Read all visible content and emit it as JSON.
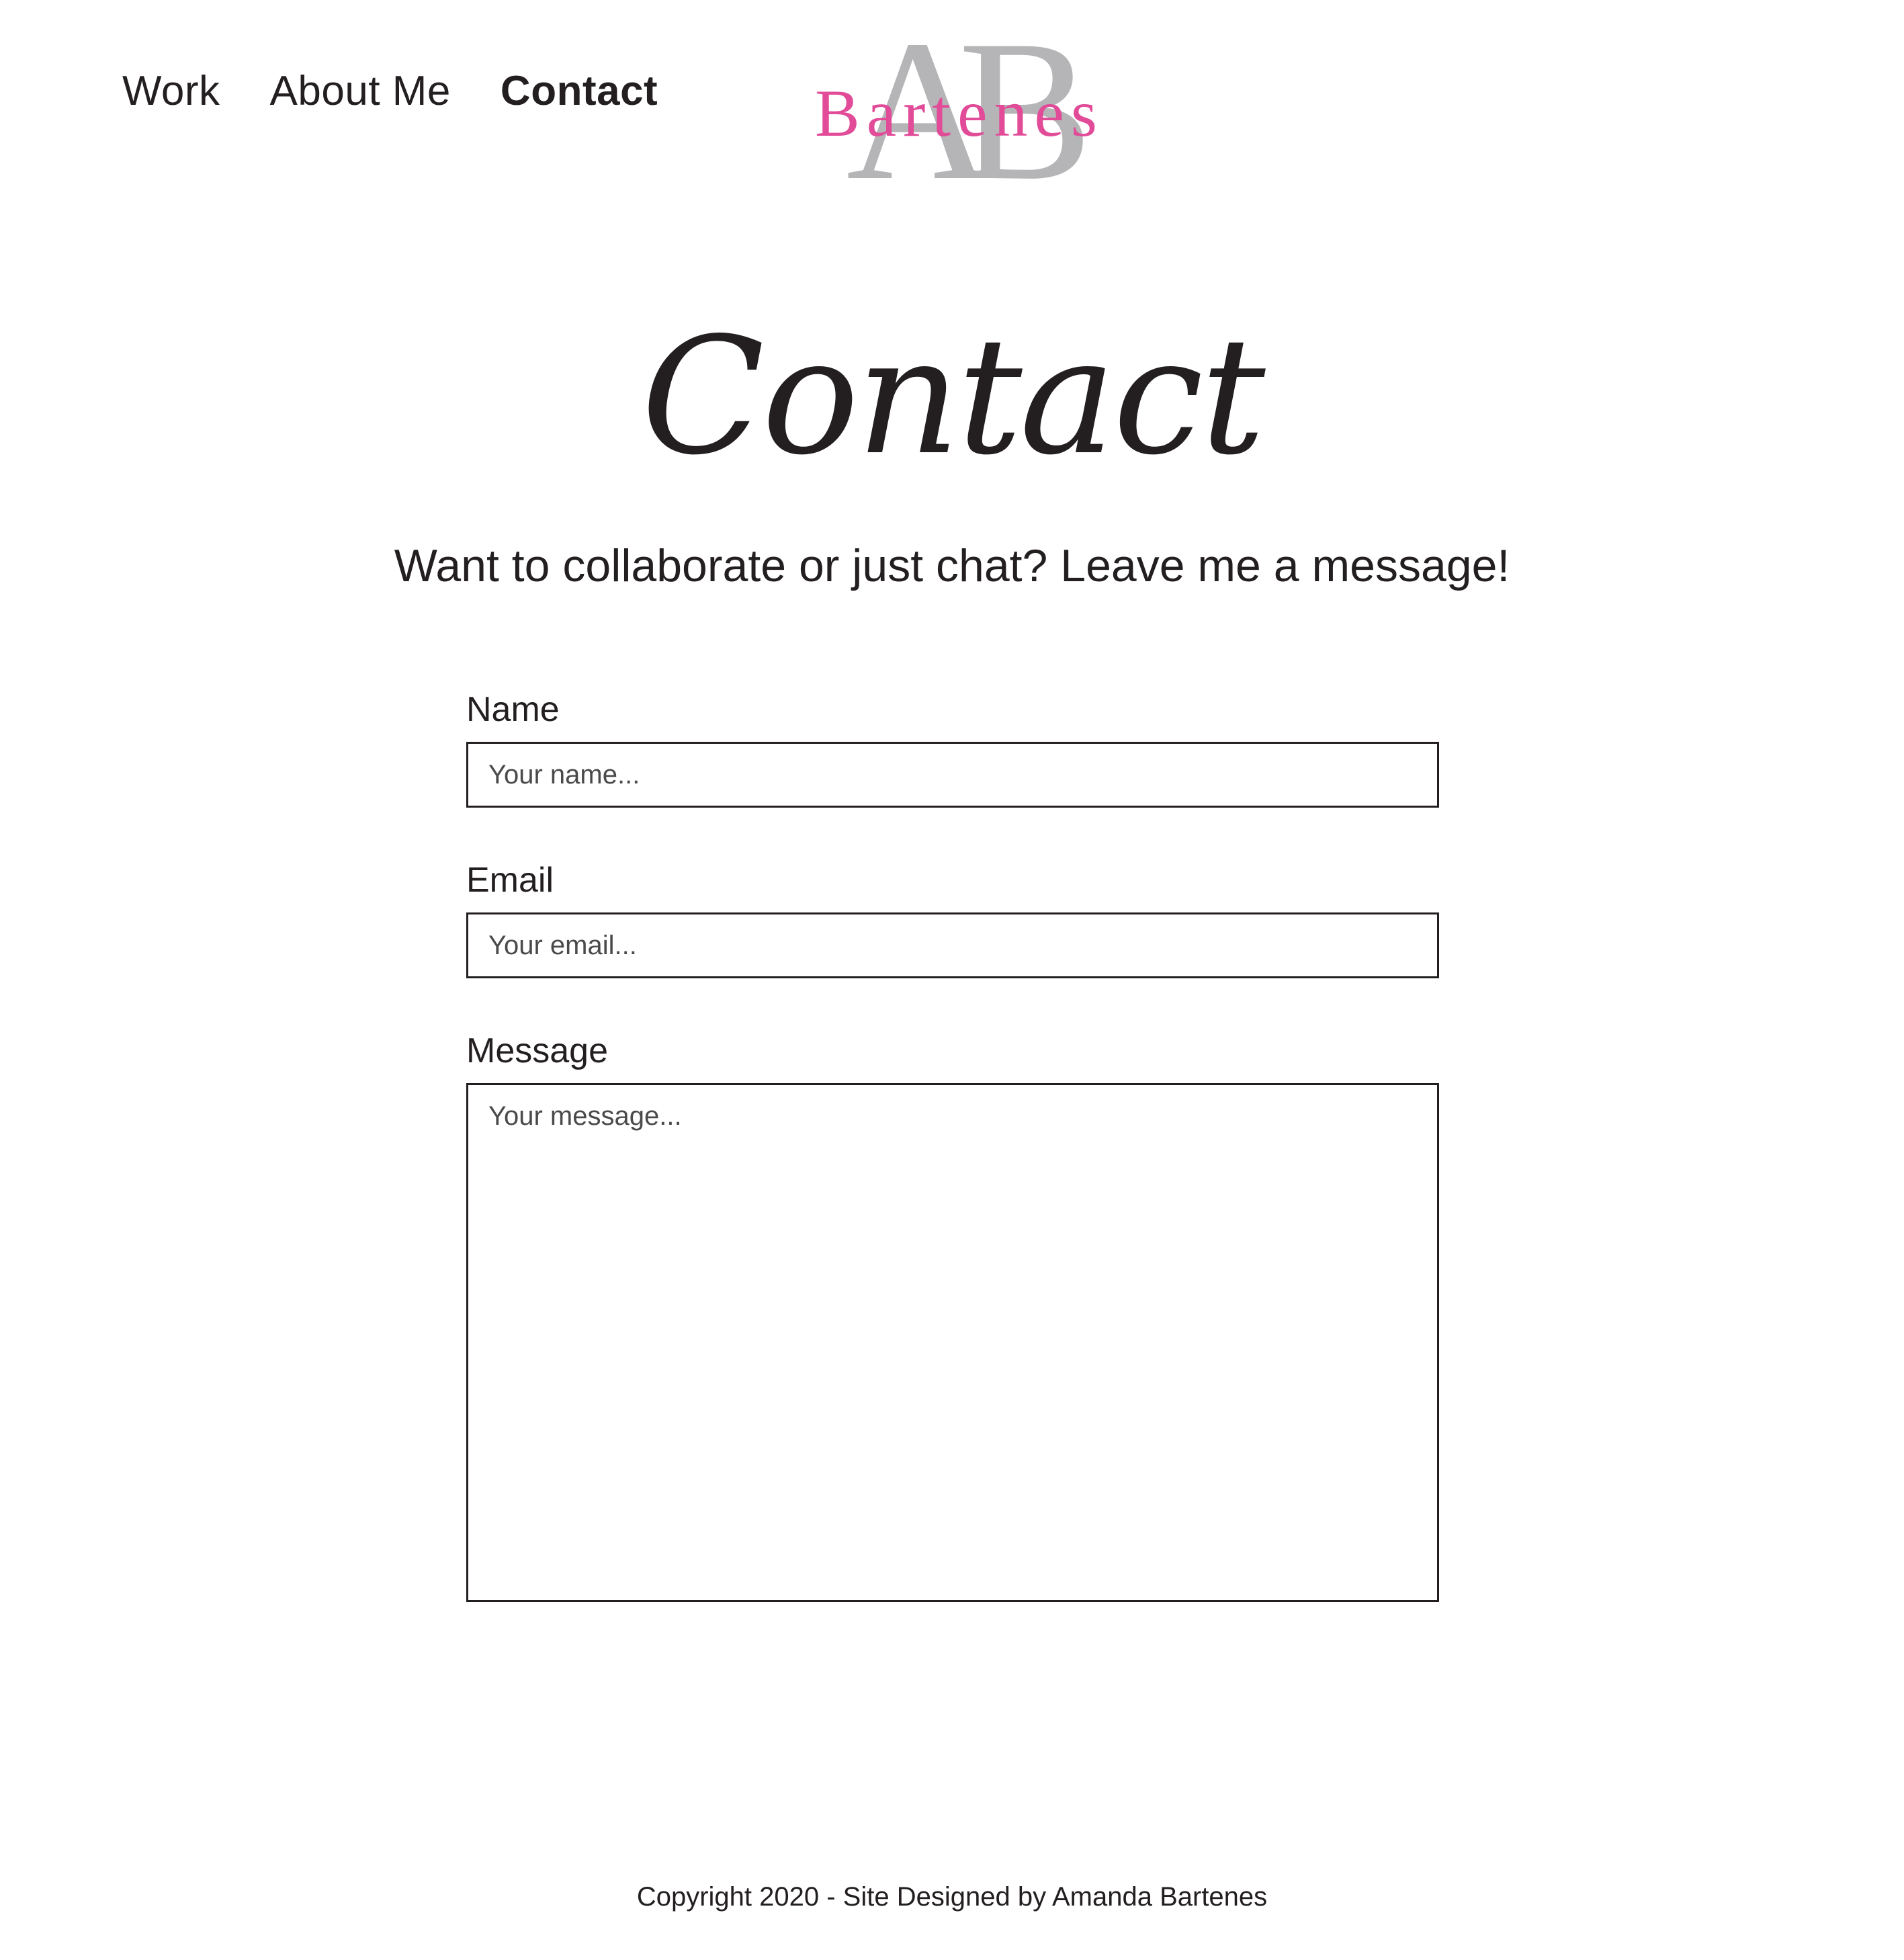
{
  "nav": {
    "items": [
      {
        "label": "Work"
      },
      {
        "label": "About Me"
      },
      {
        "label": "Contact",
        "active": true
      }
    ]
  },
  "logo": {
    "monogram": "AB",
    "name": "Bartenes",
    "colors": {
      "monogram": "#b5b5b7",
      "name": "#e14b98"
    }
  },
  "page": {
    "title": "Contact",
    "subtitle": "Want to collaborate or just chat? Leave me a message!"
  },
  "form": {
    "name": {
      "label": "Name",
      "placeholder": "Your name..."
    },
    "email": {
      "label": "Email",
      "placeholder": "Your email..."
    },
    "message": {
      "label": "Message",
      "placeholder": "Your message..."
    }
  },
  "footer": {
    "text": "Copyright 2020 - Site Designed by Amanda Bartenes"
  },
  "colors": {
    "text": "#231f20",
    "accent": "#e14b98",
    "background": "#ffffff"
  }
}
